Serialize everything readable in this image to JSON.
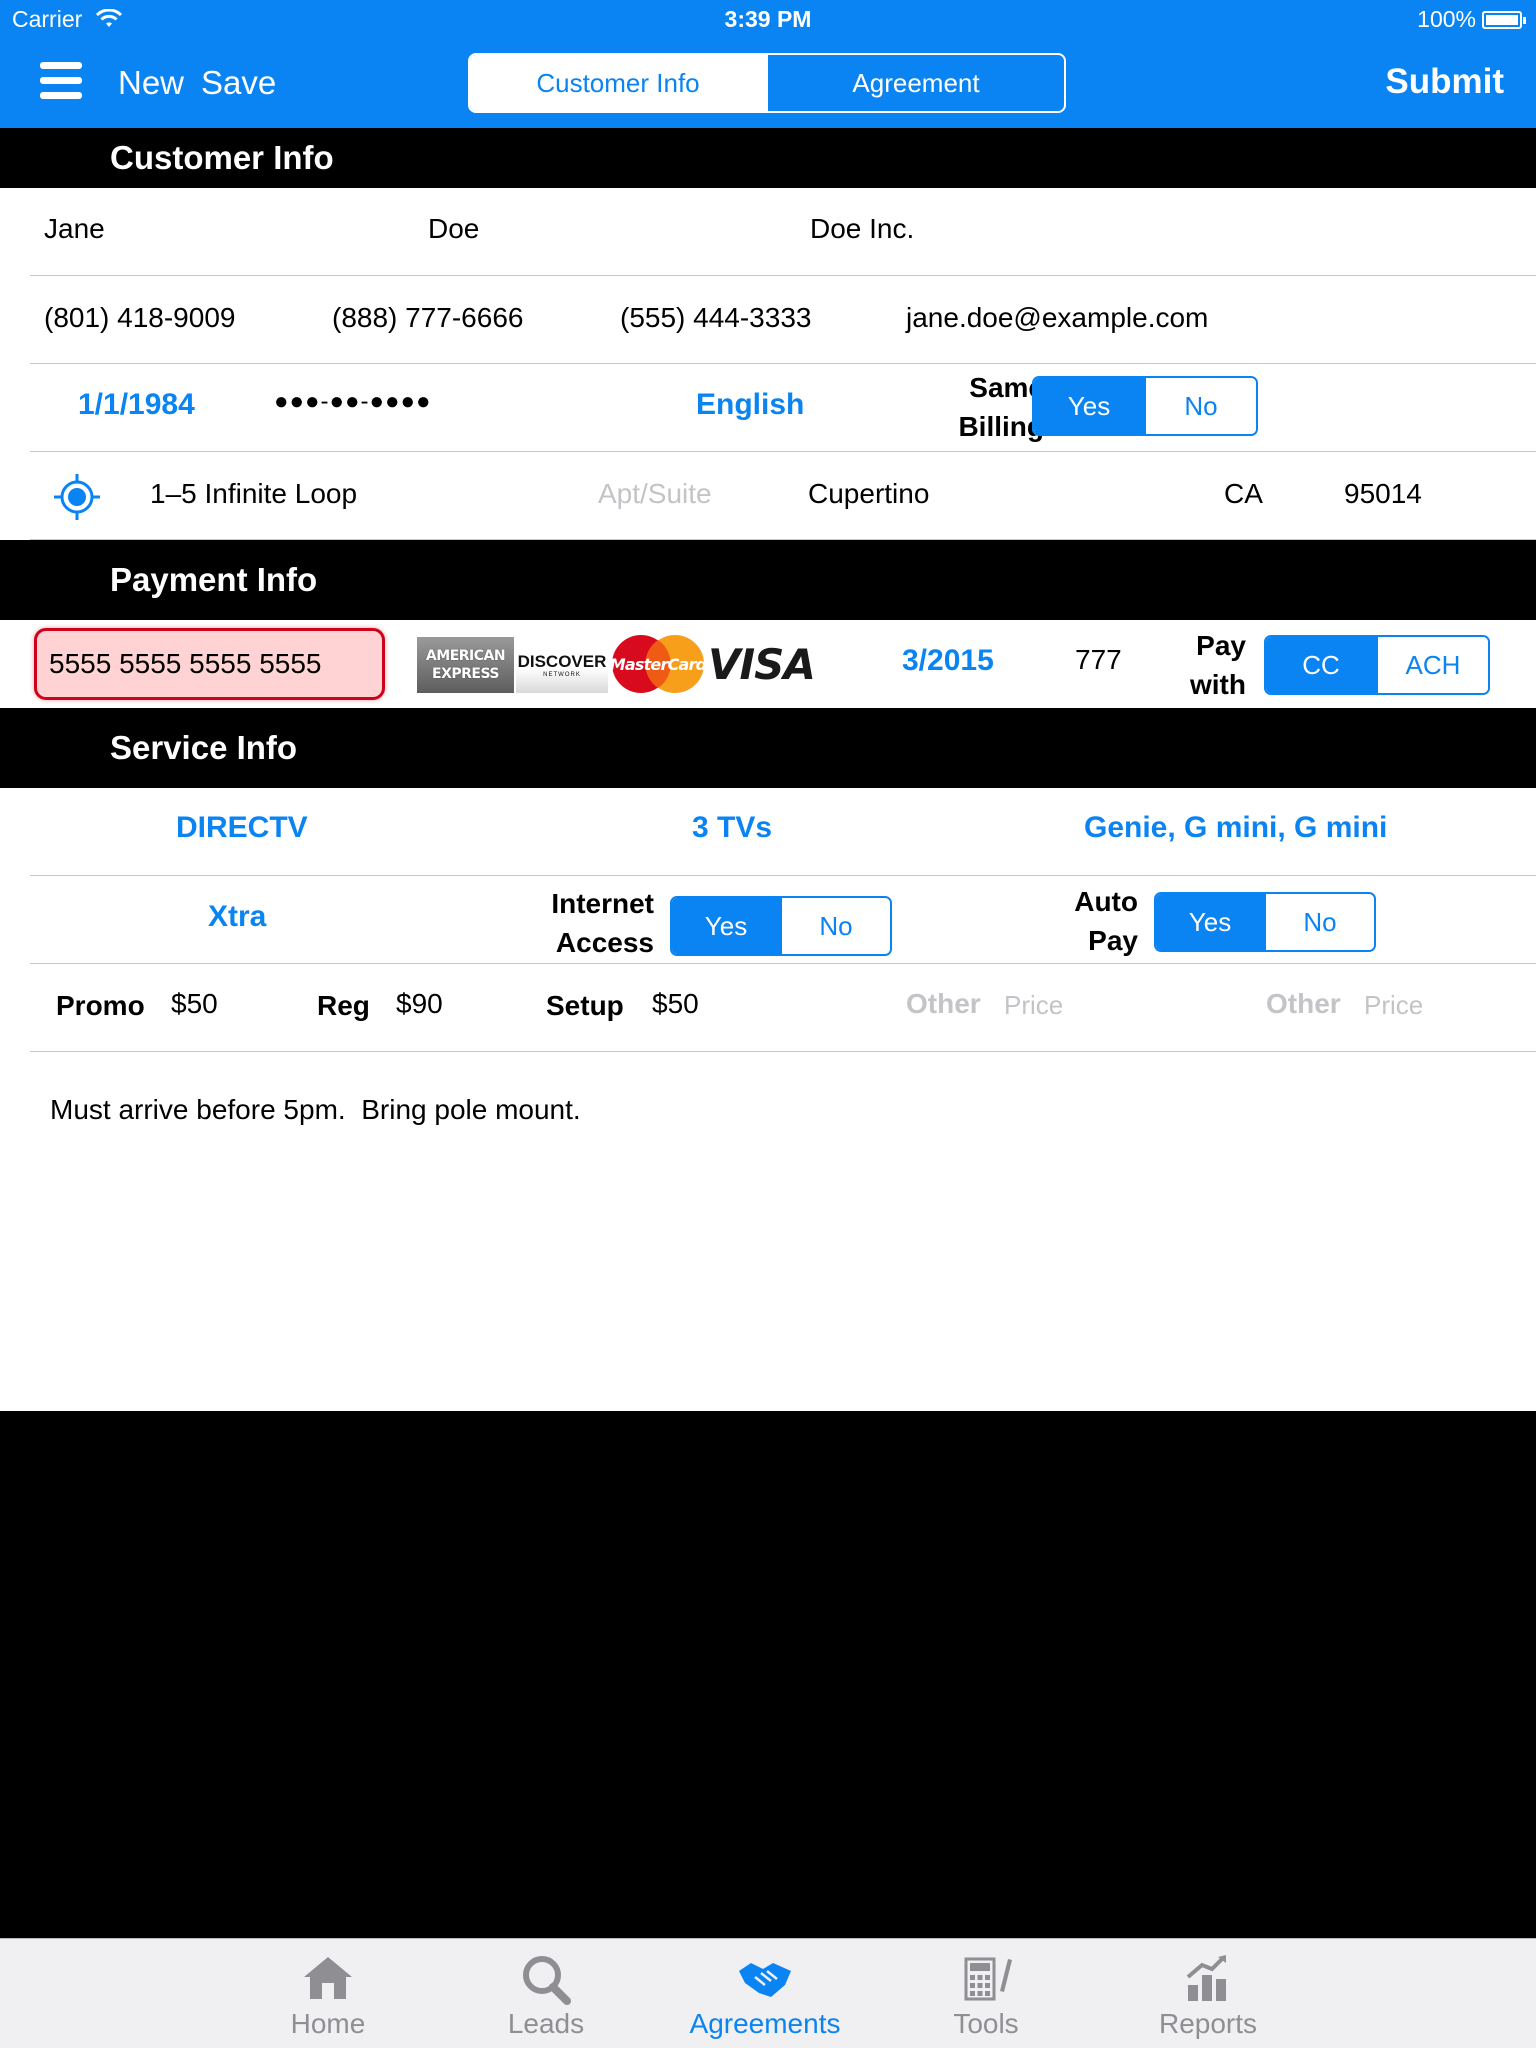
{
  "status_bar": {
    "carrier": "Carrier",
    "time": "3:39 PM",
    "battery": "100%"
  },
  "nav": {
    "new_label": "New",
    "save_label": "Save",
    "submit_label": "Submit",
    "tabs": [
      {
        "label": "Customer Info",
        "active": true
      },
      {
        "label": "Agreement",
        "active": false
      }
    ]
  },
  "customer_info": {
    "header": "Customer Info",
    "first_name": "Jane",
    "last_name": "Doe",
    "company": "Doe Inc.",
    "phone1": "(801) 418-9009",
    "phone2": "(888) 777-6666",
    "phone3": "(555) 444-3333",
    "email": "jane.doe@example.com",
    "dob": "1/1/1984",
    "ssn": "●●●-●●-●●●●",
    "language": "English",
    "same_billing_label_line1": "Same",
    "same_billing_label_line2": "Billing",
    "same_billing_yes": "Yes",
    "same_billing_no": "No",
    "same_billing_selected": "Yes",
    "street": "1–5 Infinite Loop",
    "apt_placeholder": "Apt/Suite",
    "city": "Cupertino",
    "state": "CA",
    "zip": "95014"
  },
  "payment_info": {
    "header": "Payment Info",
    "card_number": "5555 5555 5555 5555",
    "card_logos": [
      "AMERICAN EXPRESS",
      "DISCOVER",
      "MasterCard",
      "VISA"
    ],
    "discover_tagline": "NETWORK",
    "expiration": "3/2015",
    "cvv": "777",
    "pay_with_label_line1": "Pay",
    "pay_with_label_line2": "with",
    "pay_cc": "CC",
    "pay_ach": "ACH",
    "pay_selected": "CC"
  },
  "service_info": {
    "header": "Service Info",
    "provider": "DIRECTV",
    "tvs": "3 TVs",
    "receivers": "Genie, G mini, G mini",
    "package": "Xtra",
    "internet_label_line1": "Internet",
    "internet_label_line2": "Access",
    "internet_yes": "Yes",
    "internet_no": "No",
    "internet_selected": "Yes",
    "autopay_label_line1": "Auto",
    "autopay_label_line2": "Pay",
    "autopay_yes": "Yes",
    "autopay_no": "No",
    "autopay_selected": "Yes",
    "promo_label": "Promo",
    "promo_value": "$50",
    "reg_label": "Reg",
    "reg_value": "$90",
    "setup_label": "Setup",
    "setup_value": "$50",
    "other1_label": "Other",
    "other1_placeholder": "Price",
    "other2_label": "Other",
    "other2_placeholder": "Price",
    "notes": "Must arrive before 5pm.  Bring pole mount."
  },
  "tab_bar": {
    "items": [
      {
        "label": "Home",
        "icon": "home-icon",
        "active": false
      },
      {
        "label": "Leads",
        "icon": "search-icon",
        "active": false
      },
      {
        "label": "Agreements",
        "icon": "handshake-icon",
        "active": true
      },
      {
        "label": "Tools",
        "icon": "calculator-icon",
        "active": false
      },
      {
        "label": "Reports",
        "icon": "bar-chart-icon",
        "active": false
      }
    ]
  },
  "colors": {
    "accent": "#0a84f2",
    "error_fill": "#ffd3d3",
    "error_border": "#d0021b"
  }
}
